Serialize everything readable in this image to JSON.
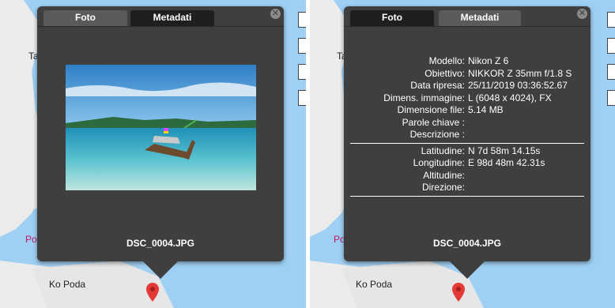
{
  "left_view": {
    "map": {
      "labels": {
        "top_partial": "Ta",
        "pink_partial": "Po",
        "place": "Ko Poda"
      }
    },
    "popup": {
      "tabs": [
        {
          "label": "Foto",
          "active": true
        },
        {
          "label": "Metadati",
          "active": false
        }
      ],
      "close_icon": "close-circle-icon",
      "photo_icon": "photo-longtail-boat-beach",
      "filename": "DSC_0004.JPG"
    }
  },
  "right_view": {
    "map": {
      "labels": {
        "top_partial": "Ta",
        "pink_partial": "Po",
        "place": "Ko Poda"
      }
    },
    "popup": {
      "tabs": [
        {
          "label": "Foto",
          "active": false
        },
        {
          "label": "Metadati",
          "active": true
        }
      ],
      "close_icon": "close-circle-icon",
      "metadata_group1": [
        {
          "key": "Modello:",
          "value": "Nikon Z 6"
        },
        {
          "key": "Obiettivo:",
          "value": "NIKKOR Z 35mm f/1.8 S"
        },
        {
          "key": "Data ripresa:",
          "value": "25/11/2019 03:36:52.67"
        },
        {
          "key": "Dimens. immagine:",
          "value": "L (6048 x 4024), FX"
        },
        {
          "key": "Dimensione file:",
          "value": "5.14 MB"
        },
        {
          "key": "Parole chiave :",
          "value": ""
        },
        {
          "key": "Descrizione :",
          "value": ""
        }
      ],
      "metadata_group2": [
        {
          "key": "Latitudine:",
          "value": "N 7d 58m 14.15s"
        },
        {
          "key": "Longitudine:",
          "value": "E 98d 48m 42.31s"
        },
        {
          "key": "Altitudine:",
          "value": ""
        },
        {
          "key": "Direzione:",
          "value": ""
        }
      ],
      "filename": "DSC_0004.JPG"
    }
  },
  "colors": {
    "sea": "#9fd0f4",
    "land": "#ececec",
    "popup_bg": "#3f3f3f",
    "tab_active": "#5a5a5a",
    "tab_inactive": "#1f1f1f",
    "pin": "#e53935",
    "label_pink": "#c2185b"
  }
}
